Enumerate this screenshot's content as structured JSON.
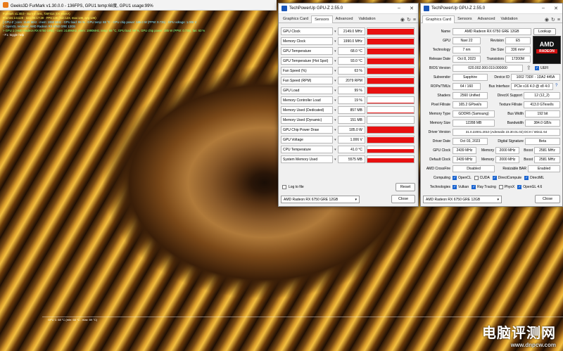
{
  "furmark": {
    "title": "Geeks3D FurMark v1.30.0.0 - 136FPS, GPU1 temp:68度, GPU1 usage:99%",
    "info": [
      "FurMark v1.30.0 - Burn-in test, 736*414 (0X MSAA)",
      "Frames:141128 - time:06:17:28 - FPS:136 (min:123, max:136, avg:136)",
      "[ GPU-Z ] core: 2149 MHz - mem: 1990 MHz - GPU load: 99 % - GPU temp: 68 °C - GPU chip power: 185.0 W (PPW: 0.735) - GPU voltage: 1.006 V",
      "> OpenGL renderer: AMD Radeon RX 6750 GRE 12GB",
      "> GPU 1 (AMD Radeon RX 6750 GRE) - core: 2149MHz, mem: 1990MHz, temp: 68 °C, GPU load: 99 %, GPU chip power: 185 W (PPW: 0.735), fan: 63 %",
      "- F1: toggle help"
    ],
    "graph_label": "GPU 1: 68 °C (min: 68 °C - max: 69 °C)"
  },
  "watermark": {
    "cn": "电脑评测网",
    "url": "www.dnpcw.com"
  },
  "gpuz_sensors": {
    "title": "TechPowerUp GPU-Z 2.55.0",
    "tabs": [
      "Graphics Card",
      "Sensors",
      "Advanced",
      "Validation"
    ],
    "active_tab": "Sensors",
    "rows": [
      {
        "name": "GPU Clock",
        "value": "2149.0 MHz",
        "level": 0.9
      },
      {
        "name": "Memory Clock",
        "value": "1990.0 MHz",
        "level": 0.9
      },
      {
        "name": "GPU Temperature",
        "value": "68.0 °C",
        "level": 0.9
      },
      {
        "name": "GPU Temperature (Hot Spot)",
        "value": "93.0 °C",
        "level": 0.9
      },
      {
        "name": "Fan Speed (%)",
        "value": "63 %",
        "level": 0.85
      },
      {
        "name": "Fan Speed (RPM)",
        "value": "2079 RPM",
        "level": 0.85
      },
      {
        "name": "GPU Load",
        "value": "99 %",
        "level": 0.95
      },
      {
        "name": "Memory Controller Load",
        "value": "19 %",
        "level": 0.12
      },
      {
        "name": "Memory Used (Dedicated)",
        "value": "857 MB",
        "level": 0.1
      },
      {
        "name": "Memory Used (Dynamic)",
        "value": "151 MB",
        "level": 0.05
      },
      {
        "name": "GPU Chip Power Draw",
        "value": "185.0 W",
        "level": 0.95
      },
      {
        "name": "GPU Voltage",
        "value": "1.006 V",
        "level": 0.85
      },
      {
        "name": "CPU Temperature",
        "value": "41.0 °C",
        "level": 0.55
      },
      {
        "name": "System Memory Used",
        "value": "5575 MB",
        "level": 0.65
      }
    ],
    "log_label": "Log to file",
    "reset_label": "Reset",
    "device": "AMD Radeon RX 6750 GRE 12GB",
    "close_label": "Close"
  },
  "gpuz_card": {
    "title": "TechPowerUp GPU-Z 2.55.0",
    "tabs": [
      "Graphics Card",
      "Sensors",
      "Advanced",
      "Validation"
    ],
    "active_tab": "Graphics Card",
    "name_label": "Name",
    "name": "AMD Radeon RX 6750 GRE 12GB",
    "lookup": "Lookup",
    "gpu_label": "GPU",
    "gpu": "Navi 22",
    "revision_label": "Revision",
    "revision": "E5",
    "tech_label": "Technology",
    "tech": "7 nm",
    "die_label": "Die Size",
    "die": "336 mm²",
    "release_label": "Release Date",
    "release": "Oct 8, 2023",
    "trans_label": "Transistors",
    "trans": "17200M",
    "bios_label": "BIOS Version",
    "bios": "020.002.000.019.000000",
    "uefi": "UEFI",
    "subvendor_label": "Subvendor",
    "subvendor": "Sapphire",
    "devid_label": "Device ID",
    "devid": "1002 73DF - 1DA2 445A",
    "rops_label": "ROPs/TMUs",
    "rops": "64 / 160",
    "bus_label": "Bus Interface",
    "bus": "PCIe x16 4.0 @ x8 4.0",
    "shaders_label": "Shaders",
    "shaders": "2560 Unified",
    "dx_label": "DirectX Support",
    "dx": "12 (12_2)",
    "pixel_label": "Pixel Fillrate",
    "pixel": "165.2 GPixel/s",
    "tex_label": "Texture Fillrate",
    "tex": "413.0 GTexel/s",
    "memtype_label": "Memory Type",
    "memtype": "GDDR6 (Samsung)",
    "buswidth_label": "Bus Width",
    "buswidth": "192 bit",
    "memsize_label": "Memory Size",
    "memsize": "12288 MB",
    "bw_label": "Bandwidth",
    "bw": "384.0 GB/s",
    "driver_label": "Driver Version",
    "driver": "31.0.22001.2010 (Adrenalin 23.30.01.02) DCH / Win11 64",
    "driverdate_label": "Driver Date",
    "driverdate": "Oct 03, 2023",
    "sig_label": "Digital Signature",
    "sig": "Beta",
    "gpuclock_label": "GPU Clock",
    "gpuclock": "2439 MHz",
    "mem_label": "Memory",
    "mem": "2000 MHz",
    "boost_label": "Boost",
    "boost": "2581 MHz",
    "defclock_label": "Default Clock",
    "defclock": "2439 MHz",
    "defmem": "2000 MHz",
    "defboost": "2581 MHz",
    "crossfire_label": "AMD CrossFire",
    "crossfire": "Disabled",
    "rebar_label": "Resizable BAR",
    "rebar": "Enabled",
    "computing_label": "Computing",
    "computing": [
      "OpenCL",
      "CUDA",
      "DirectCompute",
      "DirectML"
    ],
    "computing_on": [
      true,
      false,
      true,
      true
    ],
    "tech2_label": "Technologies",
    "techs": [
      "Vulkan",
      "Ray Tracing",
      "PhysX",
      "OpenGL 4.6"
    ],
    "techs_on": [
      true,
      true,
      false,
      true
    ],
    "device": "AMD Radeon RX 6750 GRE 12GB",
    "close_label": "Close",
    "amd_logo": "AMD",
    "radeon_logo": "RADEON"
  }
}
